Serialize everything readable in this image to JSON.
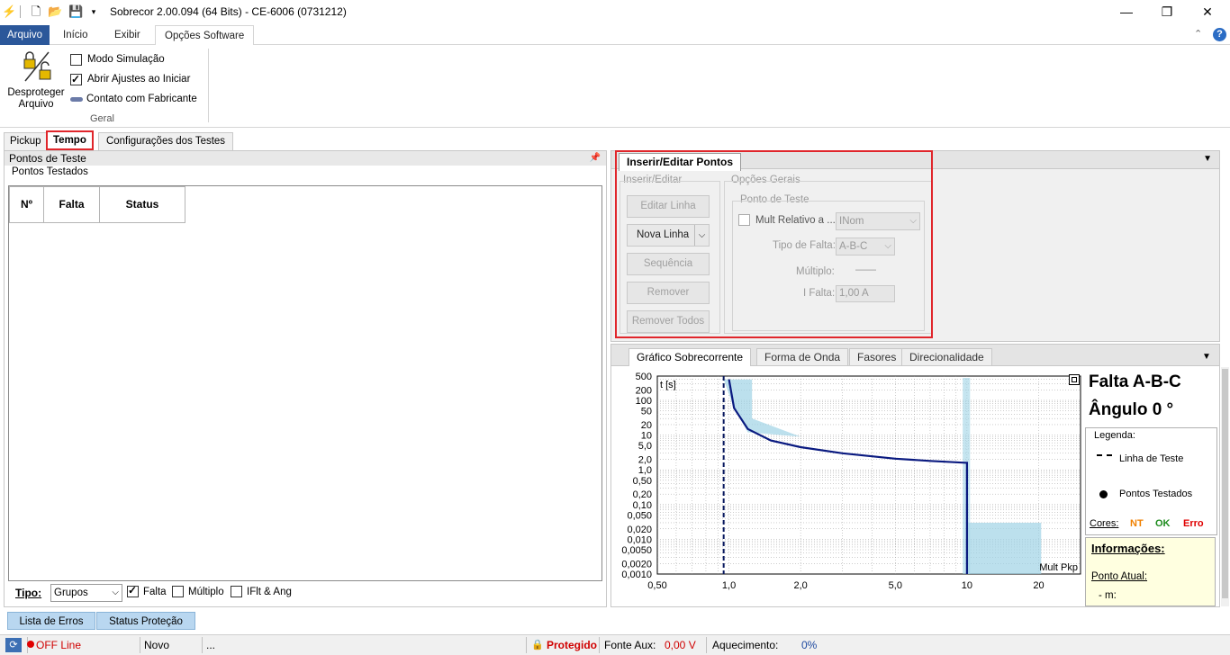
{
  "window": {
    "title": "Sobrecor 2.00.094 (64 Bits) - CE-6006 (0731212)",
    "minimize": "—",
    "maximize": "❐",
    "close": "✕"
  },
  "ribbon": {
    "tabs": [
      "Arquivo",
      "Início",
      "Exibir",
      "Opções Software"
    ],
    "unprotect_label_1": "Desproteger",
    "unprotect_label_2": "Arquivo",
    "modo_simulacao": "Modo Simulação",
    "abrir_ajustes": "Abrir Ajustes ao Iniciar",
    "contato": "Contato com Fabricante",
    "group": "Geral",
    "help": "?"
  },
  "left": {
    "tabs": [
      "Pickup",
      "Tempo",
      "Configurações dos Testes"
    ],
    "header": "Pontos de Teste",
    "subheader": "Pontos Testados",
    "columns": [
      "Nº",
      "Falta",
      "Status"
    ],
    "tipo_label": "Tipo:",
    "tipo_value": "Grupos",
    "chk_falta": "Falta",
    "chk_multiplo": "Múltiplo",
    "chk_ifl": "IFlt & Ang",
    "bottom_tabs": [
      "Lista de Erros",
      "Status Proteção"
    ]
  },
  "editor": {
    "tab": "Inserir/Editar Pontos",
    "group_insert": "Inserir/Editar",
    "group_options": "Opções Gerais",
    "group_point": "Ponto de Teste",
    "btn_editar": "Editar Linha",
    "btn_nova": "Nova Linha",
    "btn_sequencia": "Sequência",
    "btn_remover": "Remover",
    "btn_remover_todos": "Remover Todos",
    "mult_relativo": "Mult Relativo a ...",
    "mult_value": "INom",
    "tipo_falta_label": "Tipo de Falta:",
    "tipo_falta_value": "A-B-C",
    "multiplo_label": "Múltiplo:",
    "multiplo_value": "——",
    "ifalta_label": "I Falta:",
    "ifalta_value": "1,00 A"
  },
  "graph": {
    "tabs": [
      "Gráfico Sobrecorrente",
      "Forma de Onda",
      "Fasores",
      "Direcionalidade"
    ],
    "falta_title": "Falta A-B-C",
    "angulo_title": "Ângulo 0 °",
    "legenda": "Legenda:",
    "legend_line": "Linha de Teste",
    "legend_points": "Pontos Testados",
    "cores": "Cores:",
    "nt": "NT",
    "ok": "OK",
    "erro": "Erro",
    "info_title": "Informações:",
    "ponto_atual": "Ponto Atual:",
    "m_label": "- m:",
    "nt_color": "#f08000",
    "ok_color": "#1e8c1e",
    "erro_color": "#e00000"
  },
  "chart_data": {
    "type": "line",
    "title": "",
    "ylabel": "t [s]",
    "xlabel": "Mult Pkp",
    "x_scale": "log",
    "y_scale": "log",
    "xlim": [
      0.5,
      30
    ],
    "ylim": [
      0.001,
      500
    ],
    "x_ticks": [
      0.5,
      1,
      2,
      5,
      10,
      20
    ],
    "x_tick_labels": [
      "0,50",
      "1,0",
      "2,0",
      "5,0",
      "10",
      "20"
    ],
    "y_ticks": [
      500,
      200,
      100,
      50,
      20,
      10,
      5,
      2,
      1,
      0.5,
      0.2,
      0.1,
      0.05,
      0.02,
      0.01,
      0.005,
      0.002,
      0.001
    ],
    "y_tick_labels": [
      "500",
      "200",
      "100",
      "50",
      "20",
      "10",
      "5,0",
      "2,0",
      "1,0",
      "0,50",
      "0,20",
      "0,10",
      "0,050",
      "0,020",
      "0,010",
      "0,0050",
      "0,0020",
      "0,0010"
    ],
    "grid": true,
    "series": [
      {
        "points": [
          [
            1.0,
            400
          ],
          [
            1.05,
            60
          ],
          [
            1.2,
            15
          ],
          [
            1.5,
            7
          ],
          [
            2.0,
            4.5
          ],
          [
            3.0,
            3.0
          ],
          [
            5.0,
            2.1
          ],
          [
            7.0,
            1.8
          ],
          [
            9.8,
            1.6
          ],
          [
            10.0,
            1.6
          ],
          [
            10.0,
            0.001
          ]
        ]
      }
    ],
    "pickup_line_x": 0.95,
    "shaded_regions": [
      {
        "x": [
          0.95,
          1.25
        ],
        "y_top_note": "band"
      },
      {
        "x": [
          10.0,
          20.5
        ],
        "y": [
          0.001,
          0.03
        ]
      }
    ],
    "line_color": "#0a1a80",
    "band_color": "#9fd3e6"
  },
  "status": {
    "offline": "OFF Line",
    "novo": "Novo",
    "dots": "...",
    "protegido": "Protegido",
    "fonte_aux_label": "Fonte Aux:",
    "fonte_aux_value": "0,00 V",
    "aquecimento_label": "Aquecimento:",
    "aquecimento_value": "0%"
  }
}
